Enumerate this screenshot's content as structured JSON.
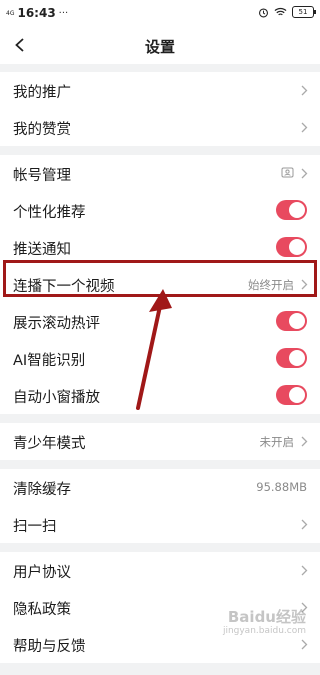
{
  "status_bar": {
    "network": "4G",
    "time": "16:43",
    "dots": "···",
    "battery": "51"
  },
  "header": {
    "title": "设置"
  },
  "groups": [
    {
      "items": [
        {
          "label": "我的推广",
          "type": "arrow"
        },
        {
          "label": "我的赞赏",
          "type": "arrow"
        }
      ]
    },
    {
      "items": [
        {
          "label": "帐号管理",
          "type": "icon-arrow",
          "icon": "id-card-icon"
        },
        {
          "label": "个性化推荐",
          "type": "toggle",
          "on": true
        },
        {
          "label": "推送通知",
          "type": "toggle",
          "on": true
        },
        {
          "label": "连播下一个视频",
          "type": "value",
          "value": "始终开启"
        },
        {
          "label": "展示滚动热评",
          "type": "toggle",
          "on": true
        },
        {
          "label": "AI智能识别",
          "type": "toggle",
          "on": true
        },
        {
          "label": "自动小窗播放",
          "type": "toggle",
          "on": true
        }
      ]
    },
    {
      "items": [
        {
          "label": "青少年模式",
          "type": "value",
          "value": "未开启"
        }
      ]
    },
    {
      "items": [
        {
          "label": "清除缓存",
          "type": "static-value",
          "value": "95.88MB"
        },
        {
          "label": "扫一扫",
          "type": "arrow"
        }
      ]
    },
    {
      "items": [
        {
          "label": "用户协议",
          "type": "arrow"
        },
        {
          "label": "隐私政策",
          "type": "arrow"
        },
        {
          "label": "帮助与反馈",
          "type": "arrow"
        }
      ]
    }
  ],
  "colors": {
    "toggle_on": "#e84a5f",
    "highlight": "#a01818",
    "background": "#f1f2f3"
  },
  "watermark": {
    "text": "Baidu经验",
    "sub": "jingyan.baidu.com"
  }
}
